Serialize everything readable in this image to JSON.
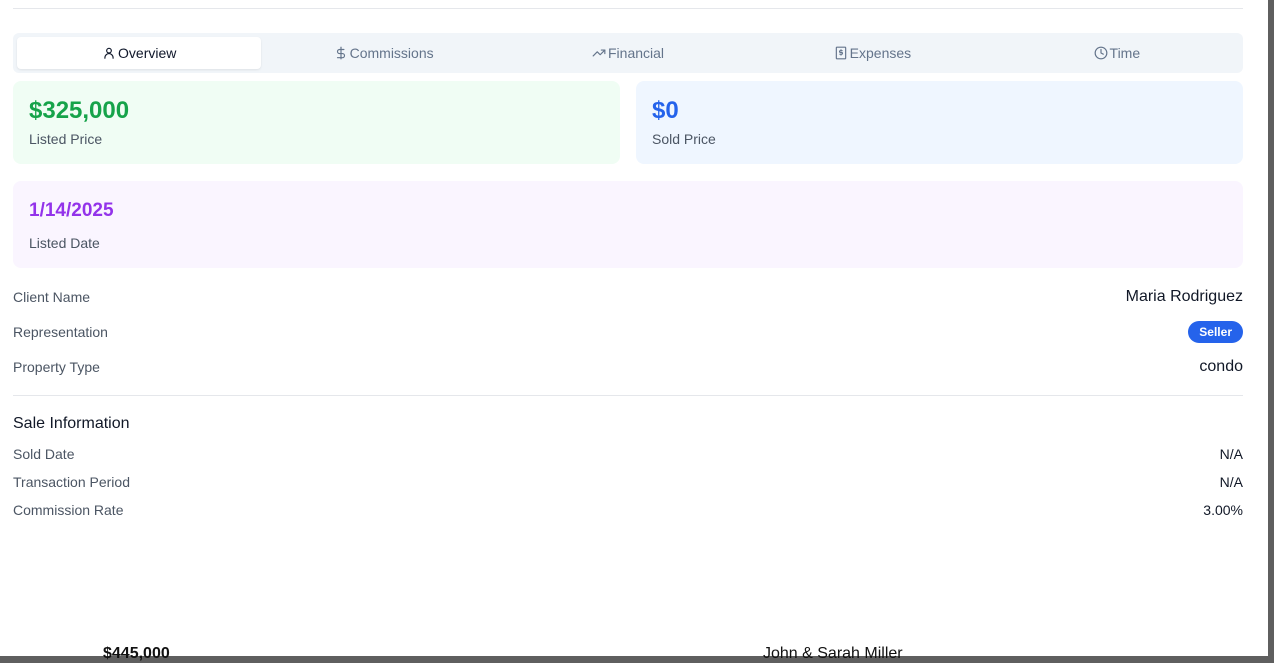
{
  "tabs": [
    {
      "label": "Overview",
      "icon": "user-icon"
    },
    {
      "label": "Commissions",
      "icon": "dollar-icon"
    },
    {
      "label": "Financial",
      "icon": "trending-up-icon"
    },
    {
      "label": "Expenses",
      "icon": "receipt-icon"
    },
    {
      "label": "Time",
      "icon": "clock-icon"
    }
  ],
  "cards": {
    "listed_price": {
      "value": "$325,000",
      "label": "Listed Price",
      "color": "#16a34a"
    },
    "sold_price": {
      "value": "$0",
      "label": "Sold Price",
      "color": "#2563eb"
    },
    "listed_date": {
      "value": "1/14/2025",
      "label": "Listed Date",
      "color": "#9333ea"
    }
  },
  "details": {
    "client_name": {
      "label": "Client Name",
      "value": "Maria Rodriguez"
    },
    "representation": {
      "label": "Representation",
      "value": "Seller"
    },
    "property_type": {
      "label": "Property Type",
      "value": "condo"
    }
  },
  "sale": {
    "title": "Sale Information",
    "sold_date": {
      "label": "Sold Date",
      "value": "N/A"
    },
    "transaction_period": {
      "label": "Transaction Period",
      "value": "N/A"
    },
    "commission_rate": {
      "label": "Commission Rate",
      "value": "3.00%"
    }
  },
  "background": {
    "price_peek": "$445,000",
    "client_peek": "John & Sarah Miller"
  }
}
